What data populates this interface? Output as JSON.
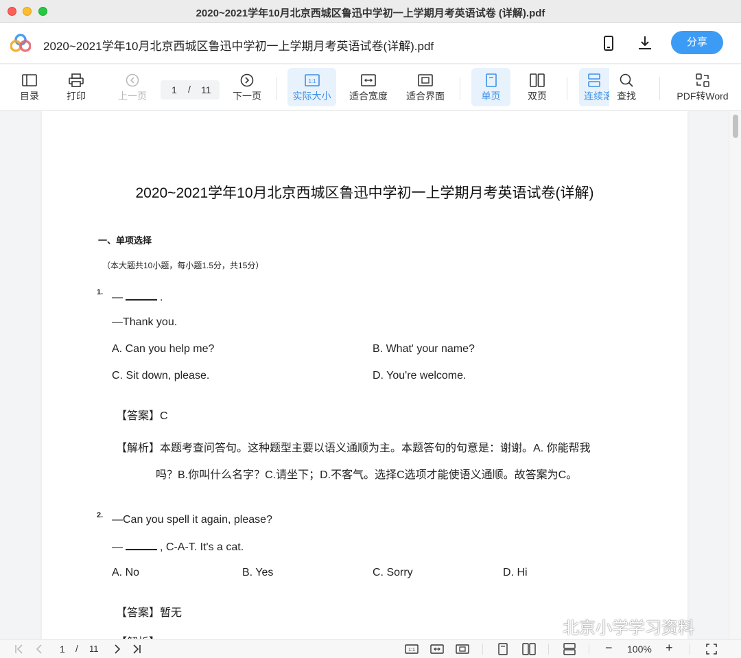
{
  "window": {
    "title": "2020~2021学年10月北京西城区鲁迅中学初一上学期月考英语试卷 (详解).pdf"
  },
  "header": {
    "doc_title": "2020~2021学年10月北京西城区鲁迅中学初一上学期月考英语试卷(详解).pdf",
    "share_label": "分享",
    "phone_icon": "phone-icon",
    "download_icon": "download-icon"
  },
  "toolbar": {
    "toc": "目录",
    "print": "打印",
    "prev": "上一页",
    "page_current": "1",
    "page_sep": "/",
    "page_total": "11",
    "next": "下一页",
    "actual_size": "实际大小",
    "fit_width": "适合宽度",
    "fit_page": "适合界面",
    "single_page": "单页",
    "double_page": "双页",
    "continuous": "连续滚动",
    "find": "查找",
    "pdf_to_word": "PDF转Word",
    "accent_color": "#3c8fe6"
  },
  "doc": {
    "title": "2020~2021学年10月北京西城区鲁迅中学初一上学期月考英语试卷(详解)",
    "section": "一、单项选择",
    "section_note": "（本大题共10小题，每小题1.5分，共15分）",
    "q1": {
      "num": "1.",
      "stem_a": "—",
      "stem_b": ".",
      "reply": "—Thank you.",
      "opt_a": "A. Can you help me?",
      "opt_b": "B. What' your name?",
      "opt_c": "C. Sit down, please.",
      "opt_d": "D. You're welcome.",
      "answer_label": "【答案】",
      "answer": "C",
      "analysis_label": "【解析】",
      "analysis_1": "本题考查问答句。这种题型主要以语义通顺为主。本题答句的句意是：谢谢。A. 你能帮我",
      "analysis_2": "吗？B.你叫什么名字？C.请坐下；D.不客气。选择C选项才能使语义通顺。故答案为C。"
    },
    "q2": {
      "num": "2.",
      "stem": "—Can you spell it again, please?",
      "reply_a": "—",
      "reply_b": ", C-A-T. It's a cat.",
      "opt_a": "A. No",
      "opt_b": "B. Yes",
      "opt_c": "C. Sorry",
      "opt_d": "D. Hi",
      "answer_label": "【答案】",
      "answer": "暂无",
      "analysis_label": "【解析】"
    }
  },
  "watermark": "北京小学学习资料",
  "bottombar": {
    "page_current": "1",
    "page_sep": "/",
    "page_total": "11",
    "zoom_minus": "−",
    "zoom": "100%",
    "zoom_plus": "+"
  }
}
